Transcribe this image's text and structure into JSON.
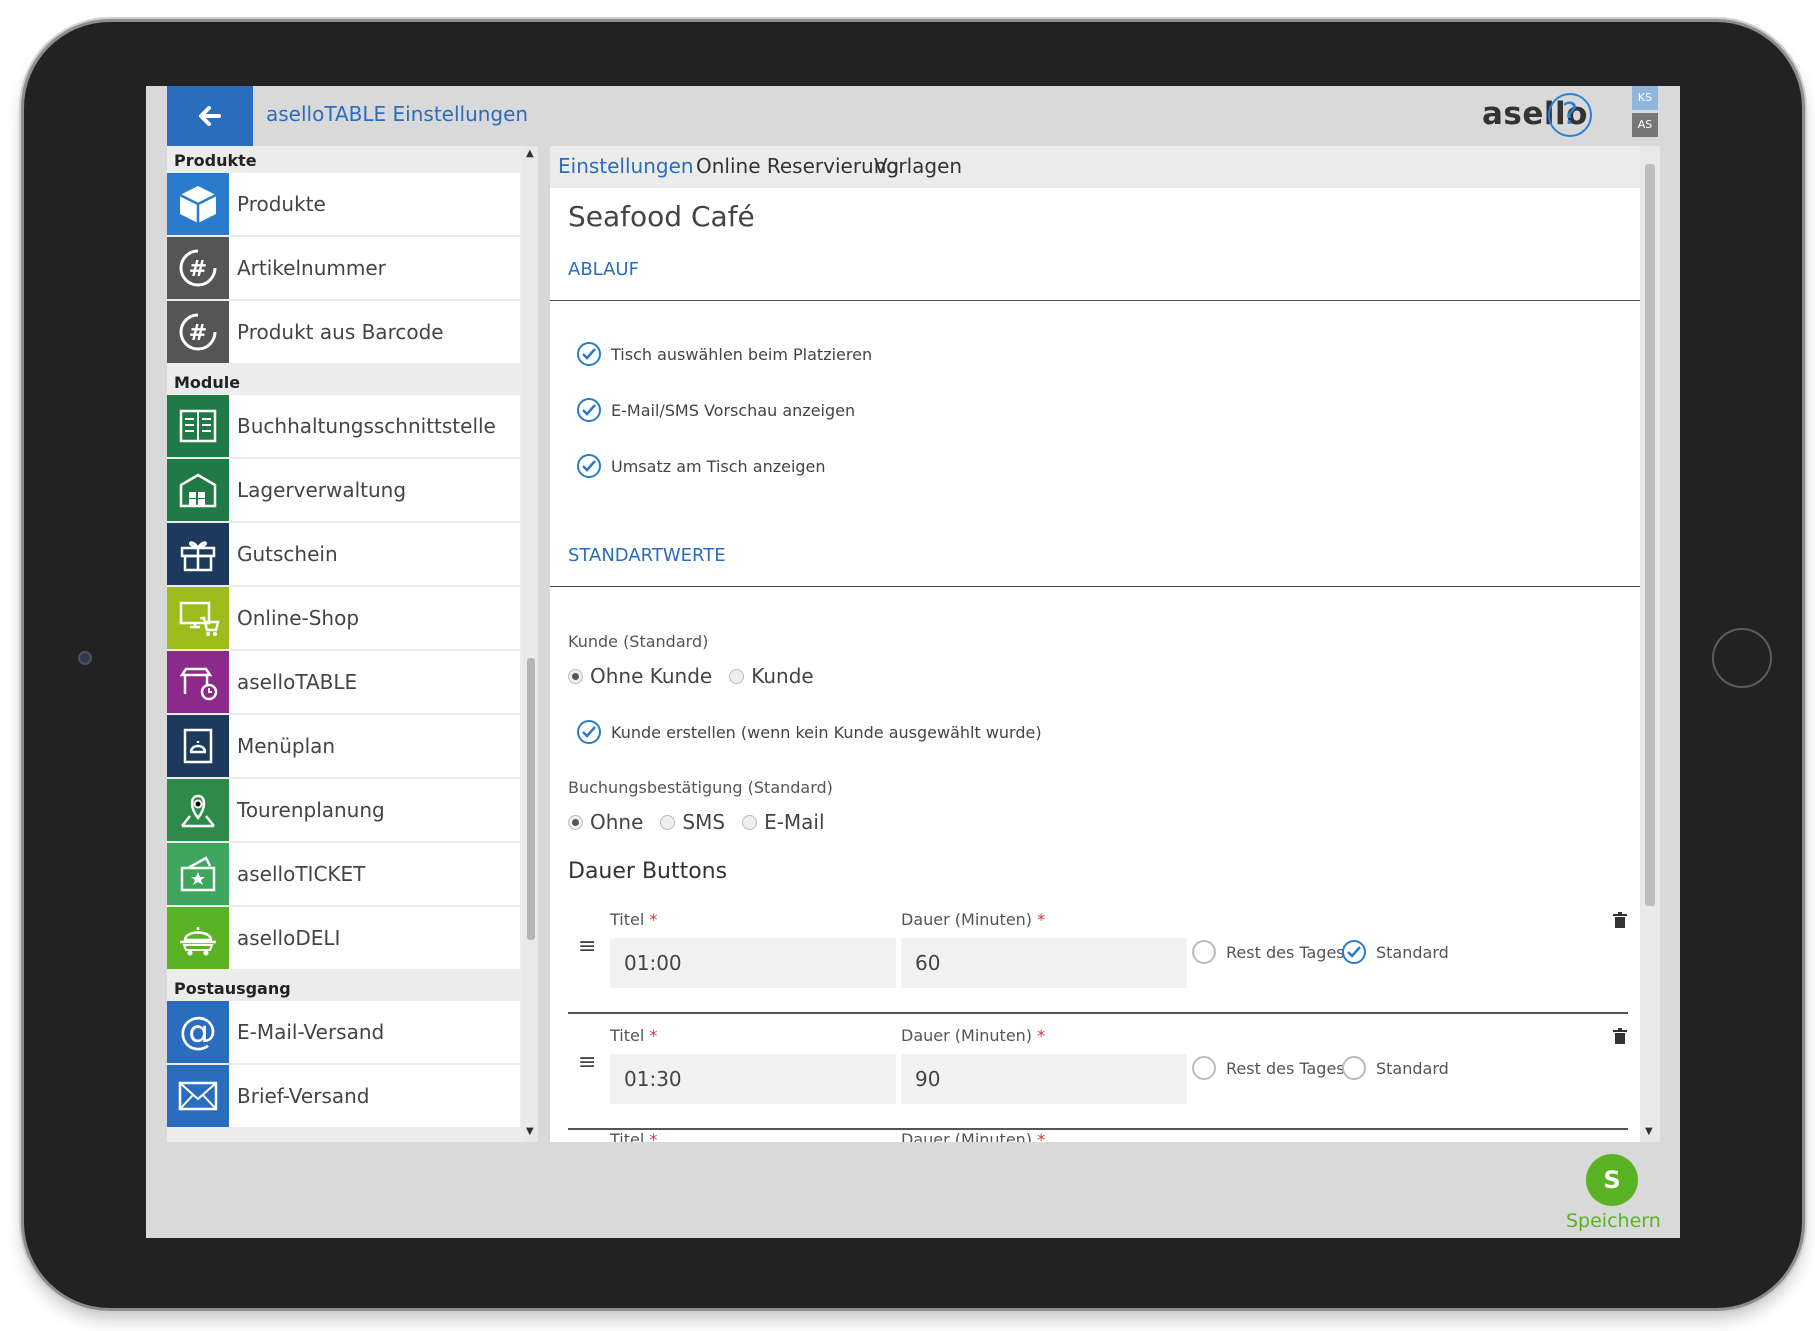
{
  "header": {
    "title": "aselloTABLE Einstellungen",
    "brand": "asello",
    "help": "?",
    "users": [
      "KS",
      "AS"
    ]
  },
  "sidebar": {
    "sections": [
      {
        "title": "Produkte",
        "items": [
          {
            "label": "Produkte",
            "icon": "box-icon",
            "color": "#2a7bcc"
          },
          {
            "label": "Artikelnummer",
            "icon": "hash-refresh-icon",
            "color": "#555555"
          },
          {
            "label": "Produkt aus Barcode",
            "icon": "hash-refresh-icon",
            "color": "#555555"
          }
        ]
      },
      {
        "title": "Module",
        "items": [
          {
            "label": "Buchhaltungsschnittstelle",
            "icon": "ledger-icon",
            "color": "#1f7a45"
          },
          {
            "label": "Lagerverwaltung",
            "icon": "warehouse-icon",
            "color": "#1f7a45"
          },
          {
            "label": "Gutschein",
            "icon": "gift-icon",
            "color": "#1b3a5e"
          },
          {
            "label": "Online-Shop",
            "icon": "shop-cart-icon",
            "color": "#9ebb1c"
          },
          {
            "label": "aselloTABLE",
            "icon": "table-clock-icon",
            "color": "#8c2a8c"
          },
          {
            "label": "Menüplan",
            "icon": "menu-book-icon",
            "color": "#1b3a5e"
          },
          {
            "label": "Tourenplanung",
            "icon": "route-pin-icon",
            "color": "#2d8a49"
          },
          {
            "label": "aselloTICKET",
            "icon": "ticket-icon",
            "color": "#3da55c"
          },
          {
            "label": "aselloDELI",
            "icon": "delivery-icon",
            "color": "#5ab325"
          }
        ]
      },
      {
        "title": "Postausgang",
        "items": [
          {
            "label": "E-Mail-Versand",
            "icon": "at-icon",
            "color": "#2a6dbd"
          },
          {
            "label": "Brief-Versand",
            "icon": "envelope-icon",
            "color": "#2a6dbd"
          }
        ]
      }
    ]
  },
  "tabs": [
    {
      "label": "Einstellungen",
      "active": true
    },
    {
      "label": "Online Reservierung"
    },
    {
      "label": "Vorlagen"
    }
  ],
  "main": {
    "title": "Seafood Café",
    "ablauf": {
      "heading": "ABLAUF",
      "checks": [
        "Tisch auswählen beim Platzieren",
        "E-Mail/SMS Vorschau anzeigen",
        "Umsatz am Tisch anzeigen"
      ]
    },
    "standard": {
      "heading": "STANDARTWERTE",
      "kunde_label": "Kunde (Standard)",
      "kunde_options": [
        "Ohne Kunde",
        "Kunde"
      ],
      "kunde_selected": "Ohne Kunde",
      "create_check": "Kunde erstellen (wenn kein Kunde ausgewählt wurde)",
      "buchung_label": "Buchungsbestätigung (Standard)",
      "buchung_options": [
        "Ohne",
        "SMS",
        "E-Mail"
      ],
      "buchung_selected": "Ohne"
    },
    "dauer": {
      "heading": "Dauer Buttons",
      "titel_label": "Titel",
      "dauer_label": "Dauer (Minuten)",
      "required": "*",
      "rest_label": "Rest des Tages",
      "standard_label": "Standard",
      "rows": [
        {
          "titel": "01:00",
          "dauer": "60",
          "standard": true
        },
        {
          "titel": "01:30",
          "dauer": "90",
          "standard": false
        }
      ]
    }
  },
  "footer": {
    "save_letter": "S",
    "save_label": "Speichern"
  },
  "colors": {
    "primary": "#2a6dbd",
    "save": "#5ab325"
  }
}
